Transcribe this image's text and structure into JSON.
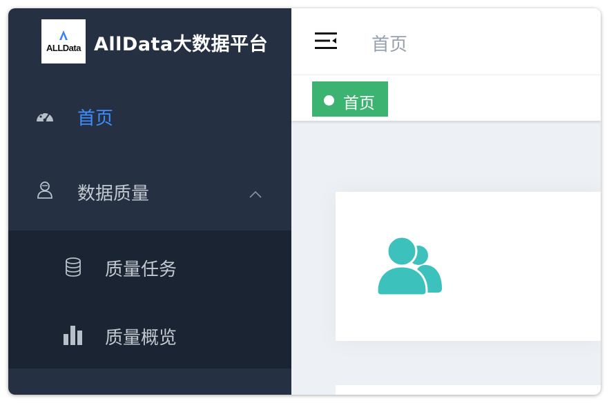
{
  "app": {
    "logo_text": "ALLData",
    "title": "AllData大数据平台"
  },
  "sidebar": {
    "items": [
      {
        "label": "首页",
        "icon": "dashboard-gauge-icon",
        "active": true
      },
      {
        "label": "数据质量",
        "icon": "user-icon",
        "expanded": true,
        "children": [
          {
            "label": "质量任务",
            "icon": "database-icon"
          },
          {
            "label": "质量概览",
            "icon": "bar-chart-icon"
          }
        ]
      }
    ]
  },
  "header": {
    "breadcrumb": "首页",
    "menu_toggle_icon": "menu-fold-icon"
  },
  "tags": [
    {
      "label": "首页",
      "active": true
    }
  ],
  "main": {
    "card_icon": "peoples-icon"
  },
  "colors": {
    "sidebar_bg": "#253142",
    "submenu_bg": "#1b2432",
    "active_text": "#3f8cff",
    "tag_active": "#3cb371",
    "card_icon": "#3cc1bd"
  }
}
